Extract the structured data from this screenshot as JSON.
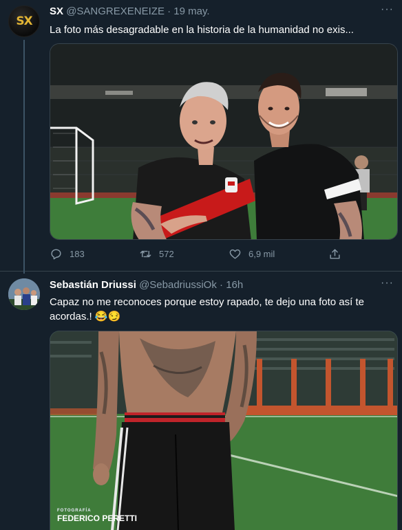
{
  "tweets": [
    {
      "author": "SX",
      "handle": "@SANGREXENEIZE",
      "date": "19 may.",
      "avatar_text": "SX",
      "text": "La foto más desagradable en la historia de la humanidad no exis...",
      "stats": {
        "replies": "183",
        "retweets": "572",
        "likes": "6,9 mil"
      }
    },
    {
      "author": "Sebastián Driussi",
      "handle": "@SebadriussiOk",
      "date": "16h",
      "text": "Capaz no me reconoces porque estoy rapado, te dejo una foto así te acordas.! 😂😏",
      "media_watermark_label": "FOTOGRAFÍA",
      "media_watermark_name": "FEDERICO PERETTI"
    }
  ],
  "icons": {
    "more": "more-horizontal-icon",
    "reply": "reply-icon",
    "retweet": "retweet-icon",
    "like": "heart-icon",
    "share": "share-icon"
  },
  "colors": {
    "background": "#15202b",
    "secondary_text": "#8899a6",
    "divider": "#38444d",
    "avatar_logo": "#e3b534"
  },
  "separator": "·",
  "more_glyph": "···"
}
